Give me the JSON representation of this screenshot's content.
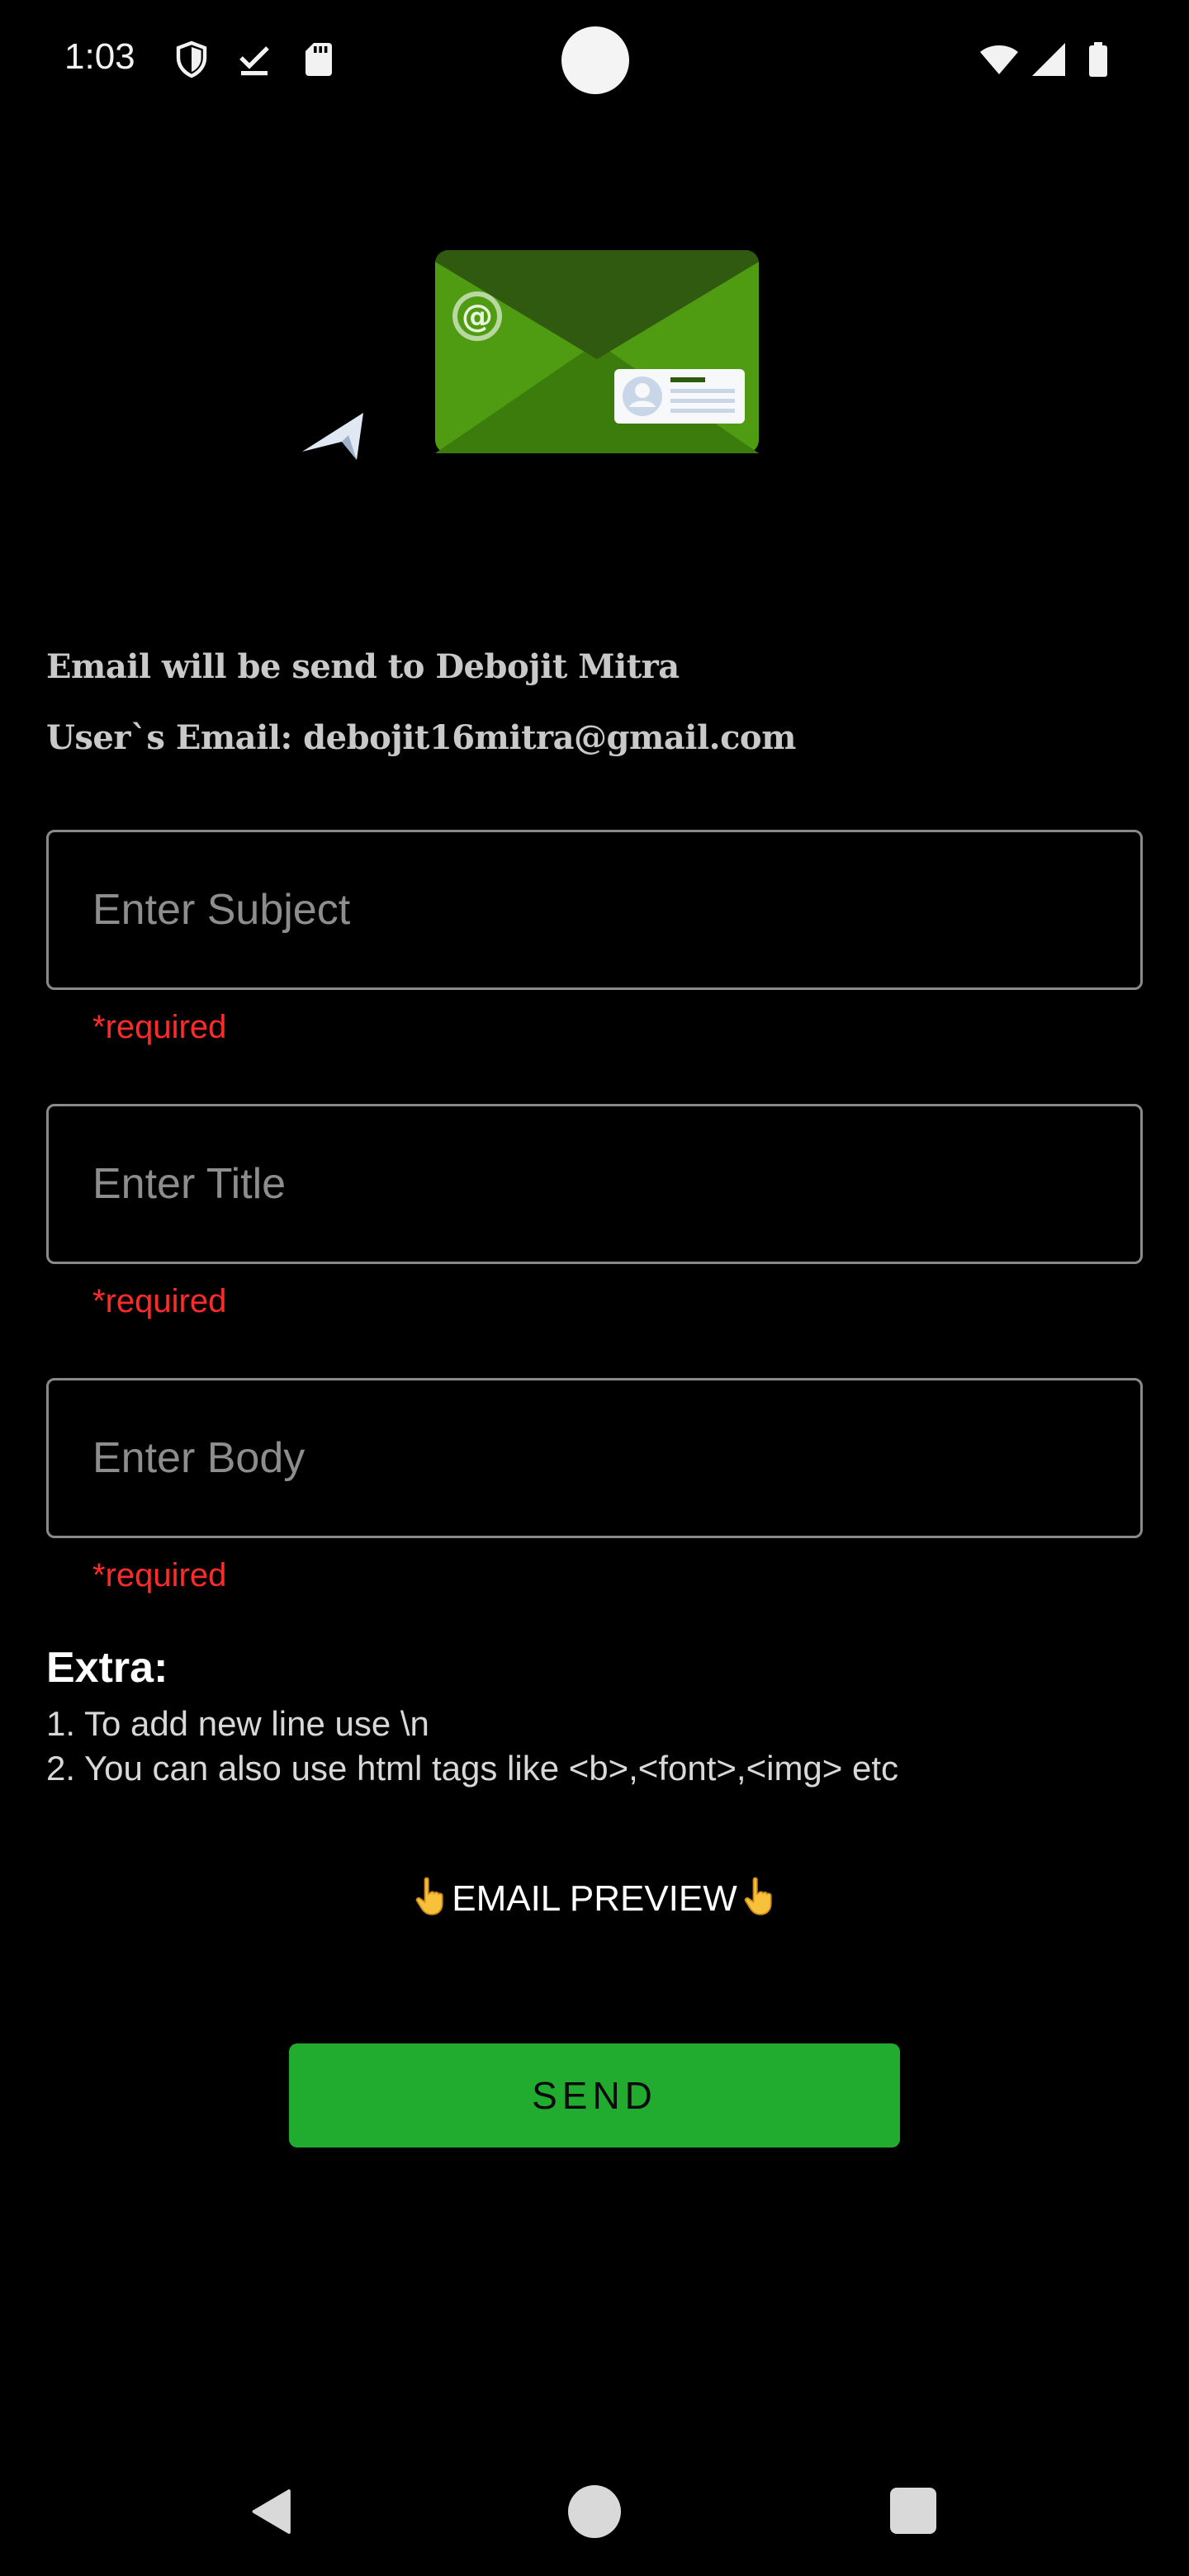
{
  "status_bar": {
    "time": "1:03",
    "icons": [
      "shield-icon",
      "download-done-icon",
      "sd-card-icon",
      "wifi-icon",
      "signal-icon",
      "battery-icon"
    ]
  },
  "info": {
    "recipient_line": "Email will be send to Debojit Mitra",
    "user_email_line": "User`s Email: debojit16mitra@gmail.com"
  },
  "form": {
    "subject_placeholder": "Enter Subject",
    "title_placeholder": "Enter Title",
    "body_placeholder": "Enter Body",
    "required_text": "*required"
  },
  "extra": {
    "heading": "Extra:",
    "line1": "1. To add new line use \\n",
    "line2": "2. You can also use html tags like <b>,<font>,<img> etc"
  },
  "preview": {
    "label": "EMAIL PREVIEW"
  },
  "send": {
    "label": "SEND"
  },
  "colors": {
    "background": "#000000",
    "accent": "#21ac2f",
    "error": "#ff2a2a",
    "field_border": "#8a8a8a"
  },
  "nav": {
    "icons": [
      "back-icon",
      "home-icon",
      "recents-icon"
    ]
  }
}
